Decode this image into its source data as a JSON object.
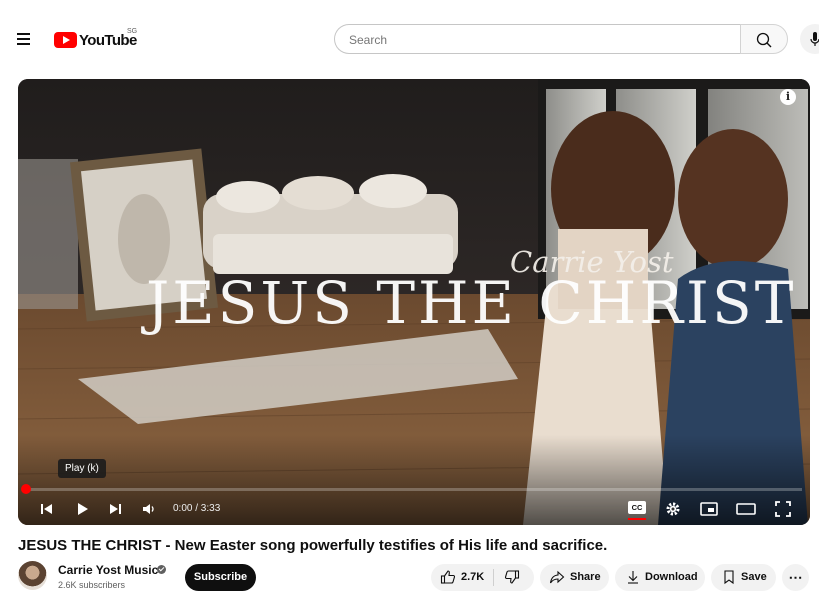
{
  "header": {
    "logo_text": "YouTube",
    "country_code": "SG",
    "search": {
      "placeholder": "Search",
      "value": ""
    }
  },
  "player": {
    "overlay_title": "JESUS THE CHRIST",
    "overlay_script": "Carrie Yost",
    "tooltip": "Play (k)",
    "time": "0:00 / 3:33",
    "progress_fraction": 0.0,
    "cc_label": "CC",
    "info_label": "i"
  },
  "video": {
    "title": "JESUS THE CHRIST - New Easter song powerfully testifies of His life and sacrifice."
  },
  "channel": {
    "name": "Carrie Yost Music",
    "subscribers": "2.6K subscribers",
    "subscribe_label": "Subscribe"
  },
  "actions": {
    "likes": "2.7K",
    "share_label": "Share",
    "download_label": "Download",
    "save_label": "Save",
    "more_label": "⋯"
  },
  "colors": {
    "brand_red": "#ff0000",
    "text_primary": "#0f0f0f",
    "pill_bg": "#f2f2f2"
  },
  "icons": [
    "menu-icon",
    "youtube-logo-icon",
    "search-icon",
    "mic-icon",
    "info-icon",
    "previous-icon",
    "play-icon",
    "next-icon",
    "volume-icon",
    "cc-icon",
    "settings-icon",
    "miniplayer-icon",
    "theater-icon",
    "fullscreen-icon",
    "verified-icon",
    "thumbs-up-icon",
    "thumbs-down-icon",
    "share-icon",
    "download-icon",
    "save-icon",
    "more-icon"
  ]
}
